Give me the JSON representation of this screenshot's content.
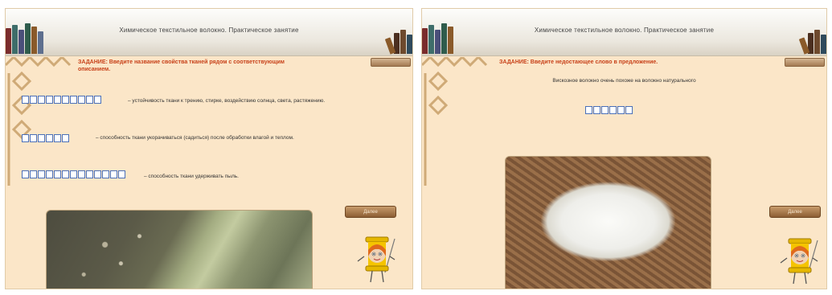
{
  "left_slide": {
    "header_title": "Химическое текстильное волокно. Практическое занятие",
    "task": "ЗАДАНИЕ: Введите название свойства тканей рядом с соответствующим описанием.",
    "items": [
      {
        "definition": "– устойчивость ткани к трению, стирке, воздействию солнца, света, растяжению."
      },
      {
        "definition": "– способность ткани укорачиваться (садиться) после обработки влагой и теплом."
      },
      {
        "definition": "– способность ткани удерживать пыль."
      }
    ],
    "next_button": "Далее"
  },
  "right_slide": {
    "header_title": "Химическое текстильное волокно. Практическое занятие",
    "task": "ЗАДАНИЕ: Введите недостающее слово в предложение.",
    "prompt": "Вискозное волокно очень похоже на волокно натурального",
    "next_button": "Далее"
  }
}
